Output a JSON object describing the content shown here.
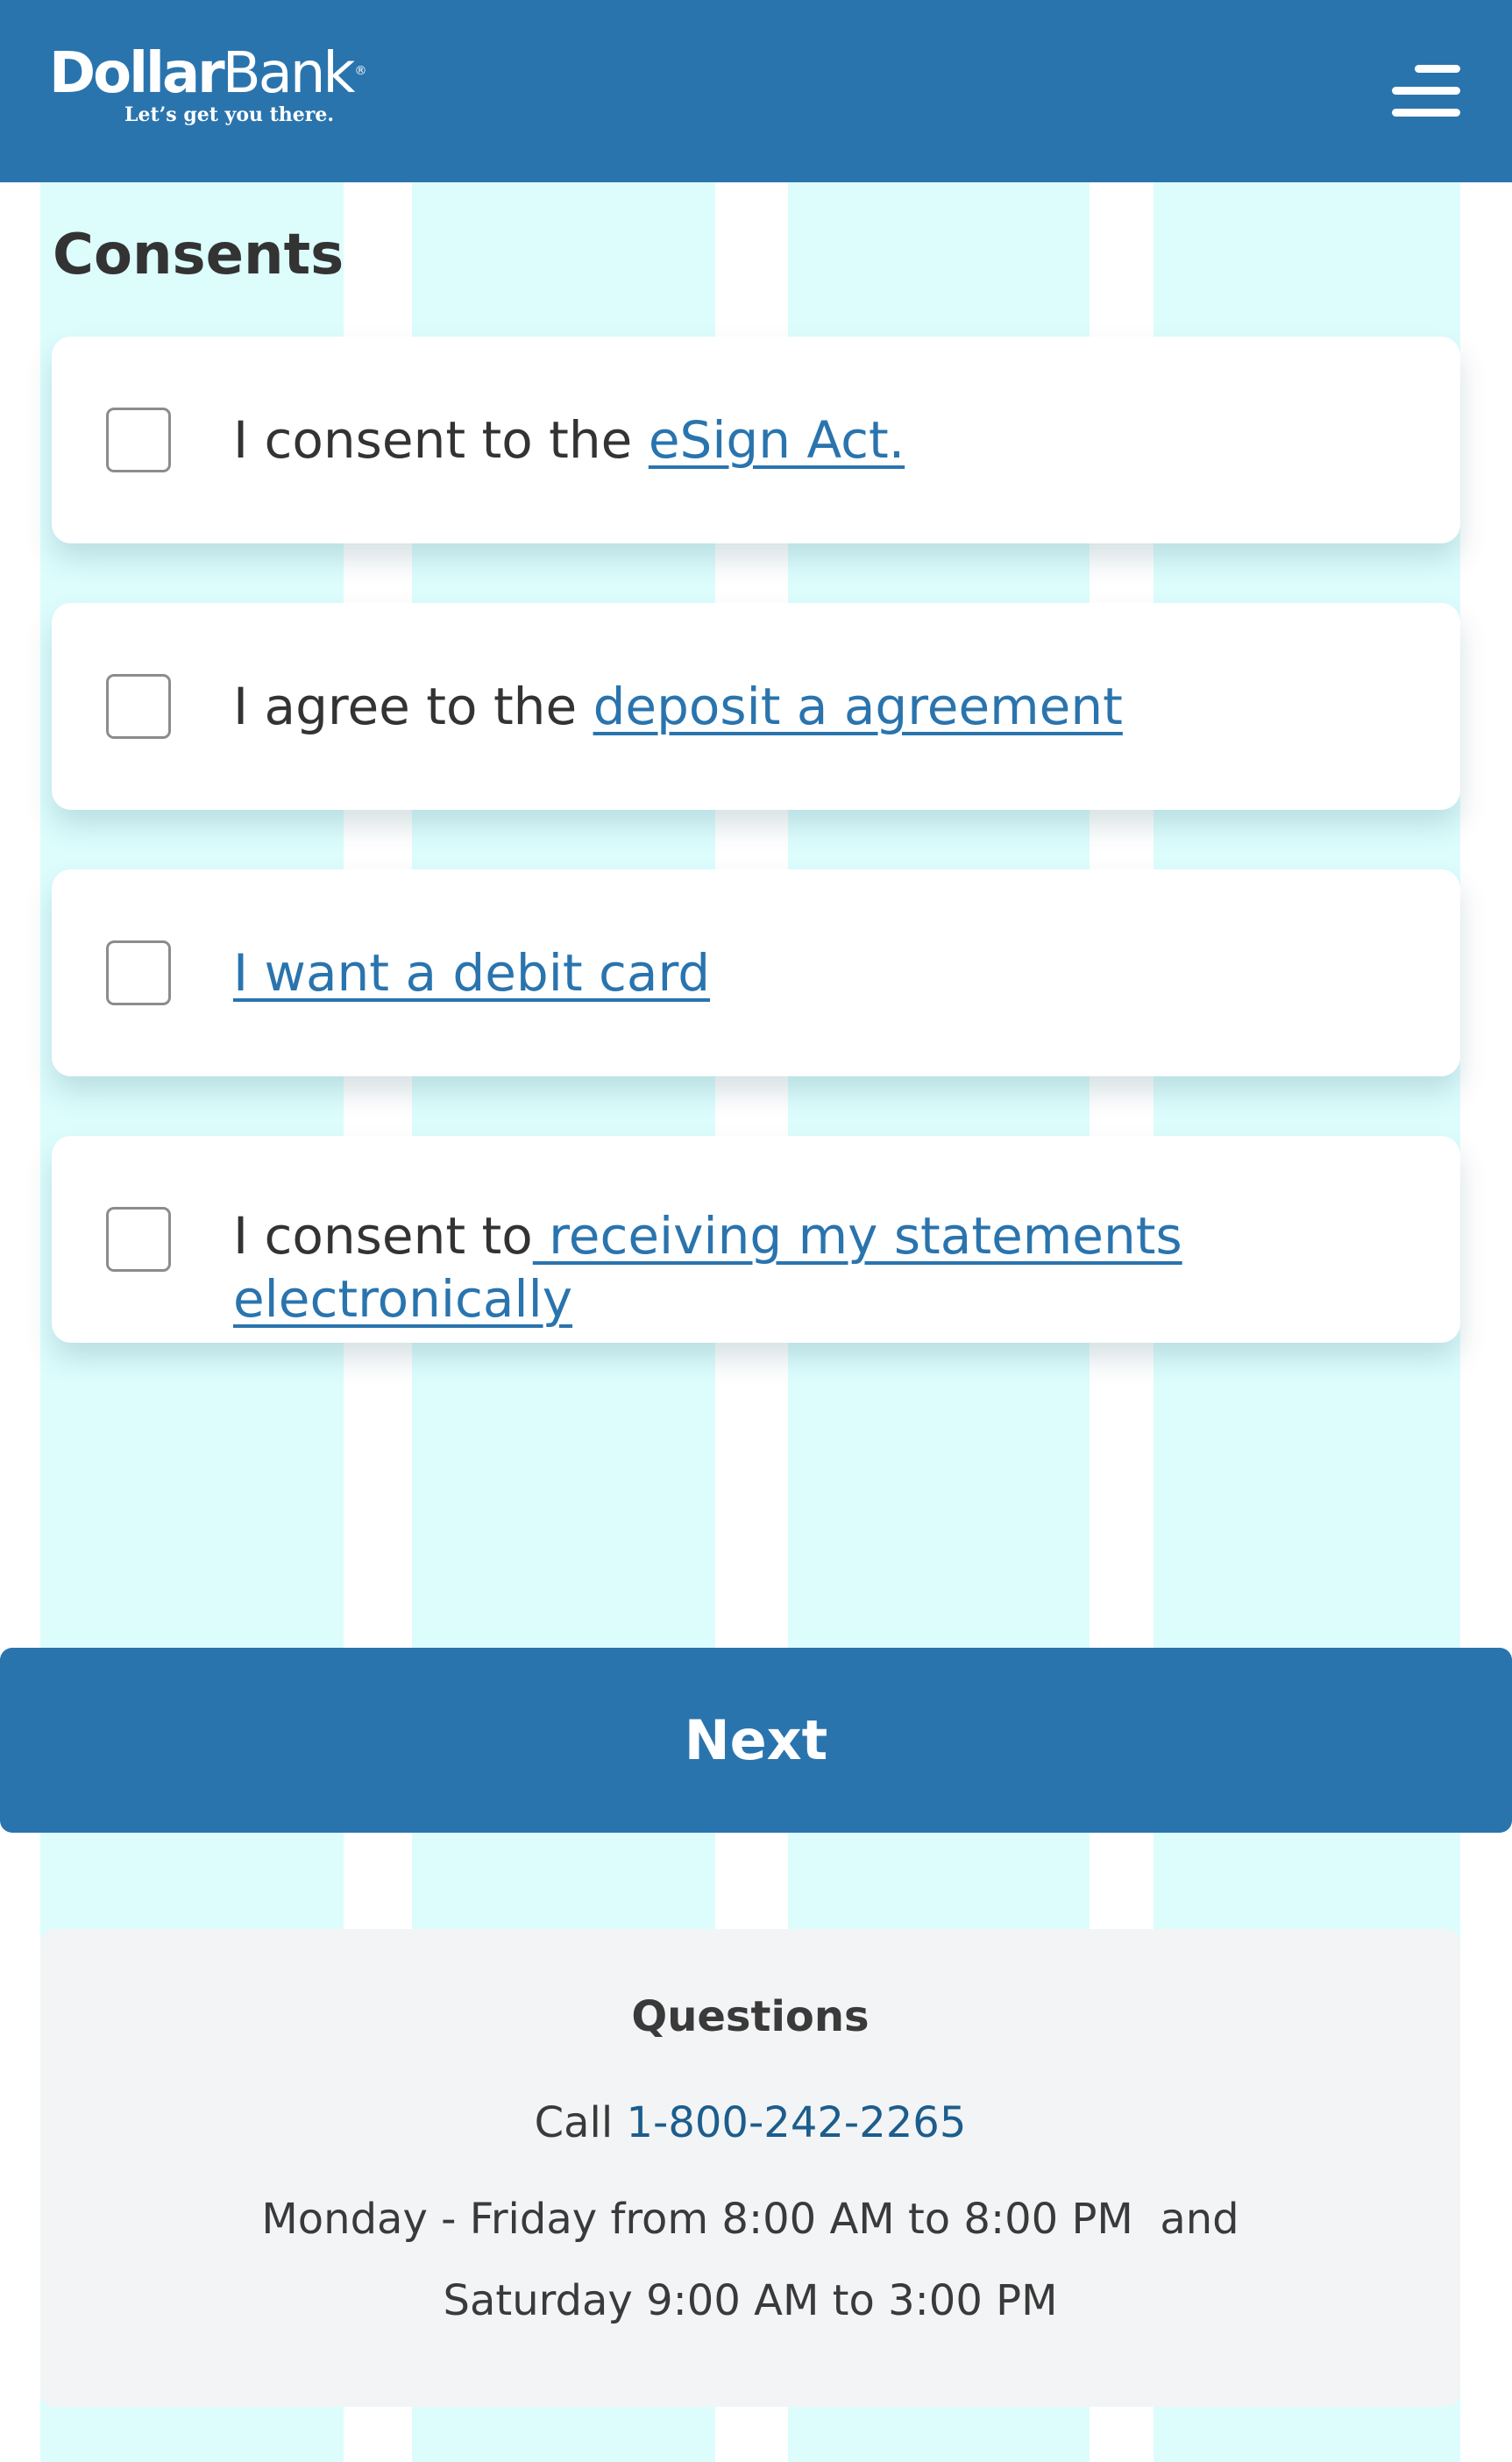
{
  "header": {
    "logo_word_bold": "Dollar",
    "logo_word_light": "Bank",
    "logo_registered": "®",
    "logo_tagline": "Let’s get you there.",
    "menu_icon": "hamburger-menu-icon",
    "background_color": "#2a74ae"
  },
  "page": {
    "title": "Consents"
  },
  "consents": [
    {
      "prefix": "I consent to the ",
      "link": "eSign Act."
    },
    {
      "prefix": "I agree to the ",
      "link": "deposit a agreement"
    },
    {
      "prefix": "",
      "link": "I want a debit card"
    },
    {
      "prefix": "I consent to",
      "link": " receiving my statements electronically"
    }
  ],
  "next_button": {
    "label": "Next"
  },
  "questions": {
    "title": "Questions",
    "call_label": "Call ",
    "phone": "1-800-242-2265",
    "hours_line1": "Monday - Friday from 8:00 AM to 8:00 PM  and",
    "hours_line2": "Saturday 9:00 AM to 3:00 PM"
  },
  "colors": {
    "brand_blue": "#2a74ae",
    "link_blue": "#2a74ae",
    "grid_overlay": "#ddfdfd",
    "footer_background": "#f3f4f5"
  }
}
